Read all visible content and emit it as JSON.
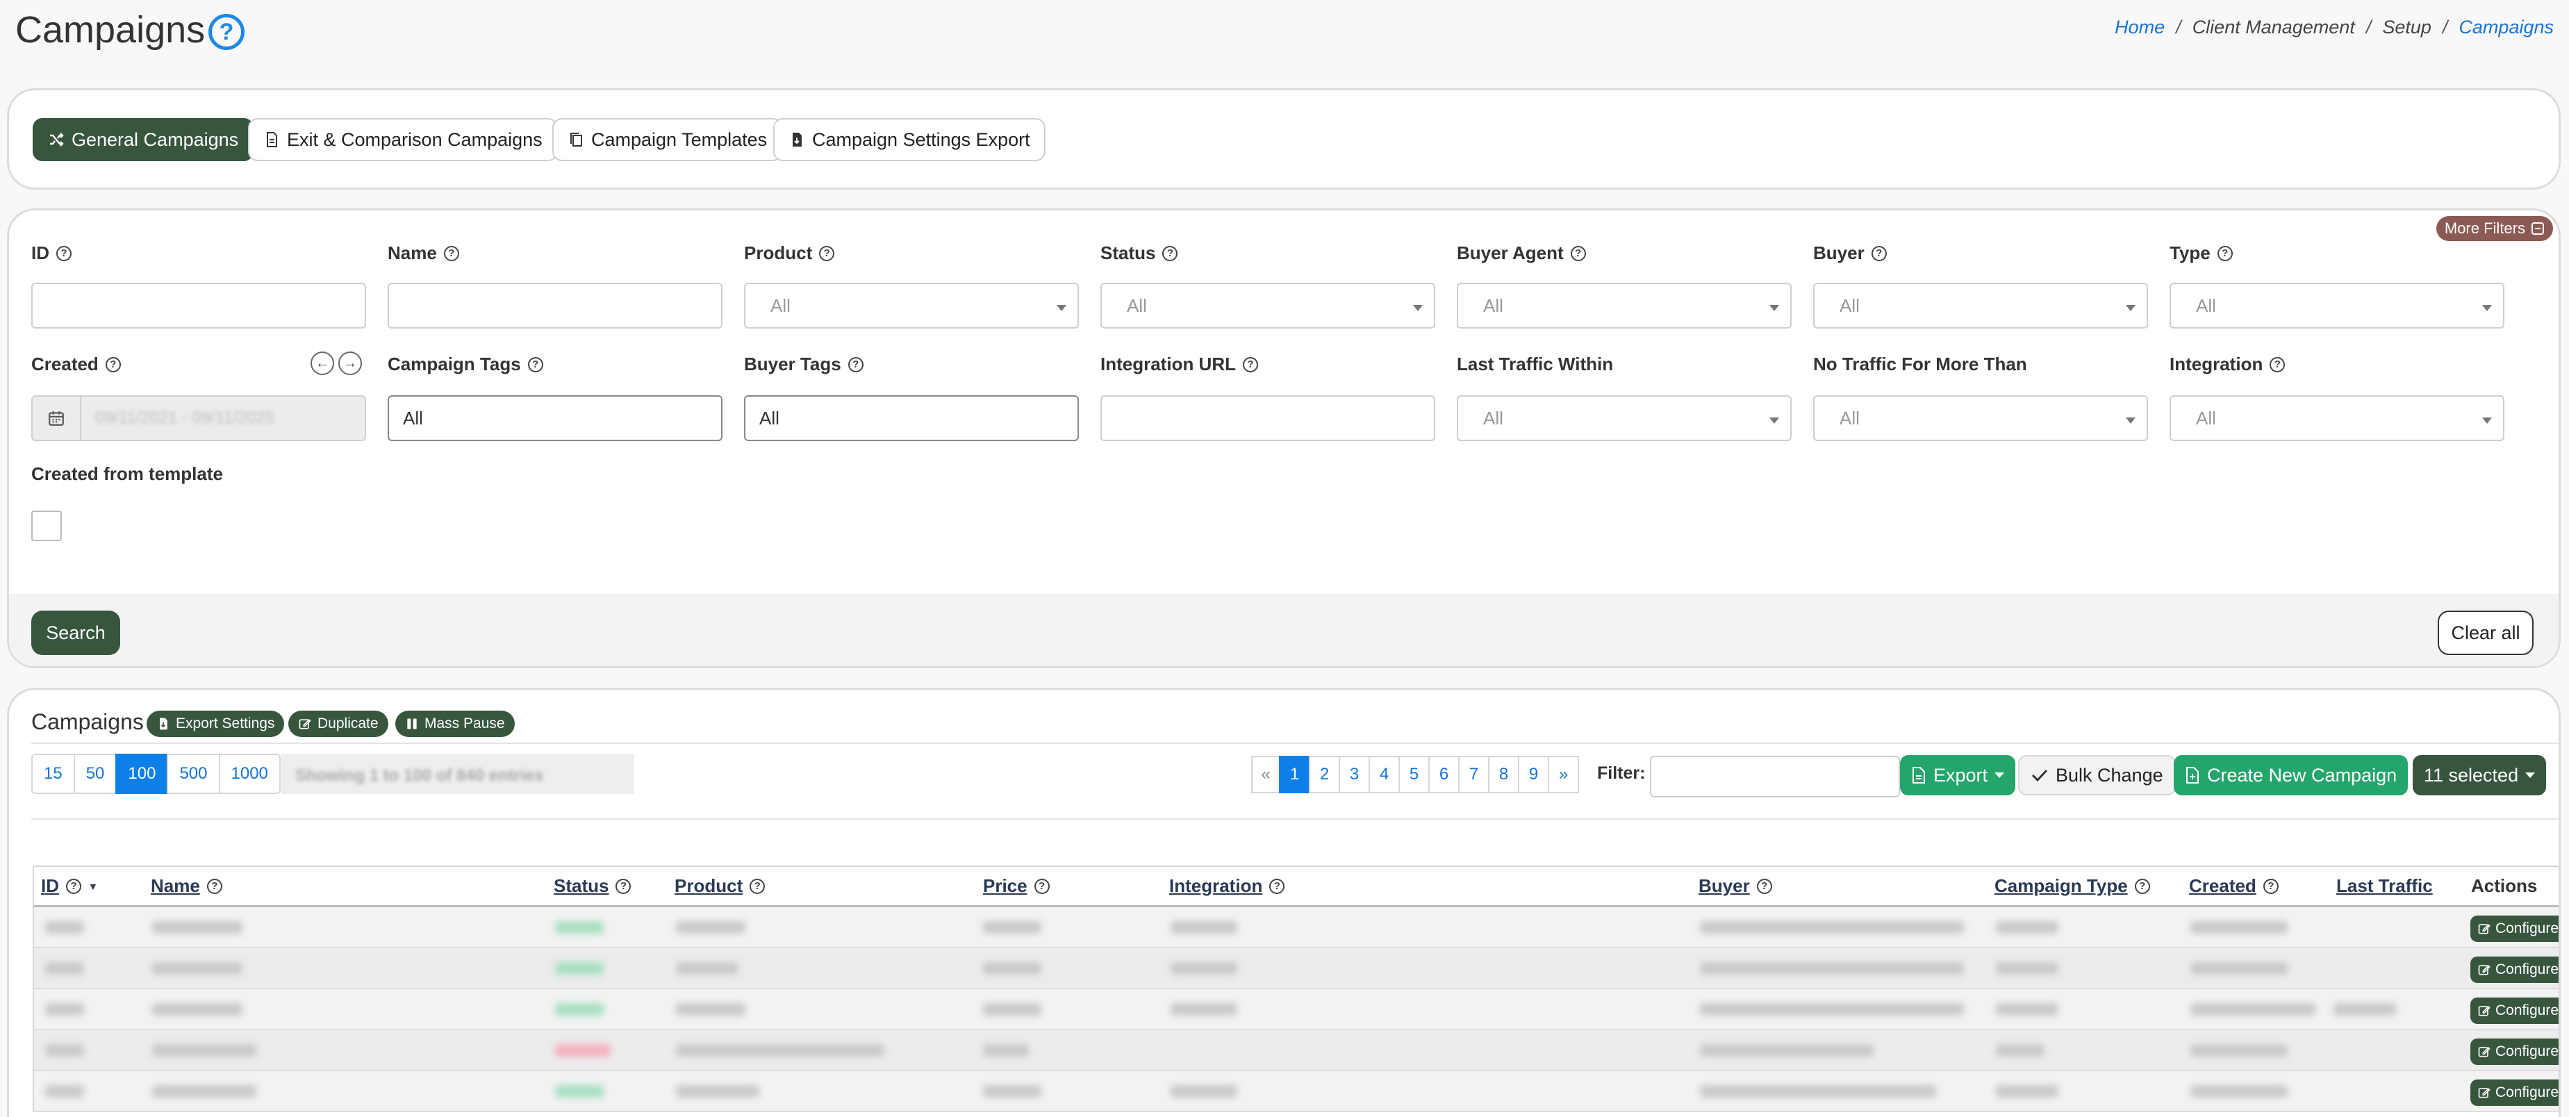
{
  "header": {
    "title": "Campaigns",
    "help_glyph": "?",
    "breadcrumb": {
      "home": "Home",
      "client_management": "Client Management",
      "setup": "Setup",
      "current": "Campaigns",
      "separator": "/"
    }
  },
  "tabs": {
    "general": "General Campaigns",
    "exit_comparison": "Exit & Comparison Campaigns",
    "templates": "Campaign Templates",
    "settings_export": "Campaign Settings Export"
  },
  "filters": {
    "more_filters": "More Filters",
    "id": "ID",
    "name": "Name",
    "product": {
      "label": "Product",
      "value": "All"
    },
    "status": {
      "label": "Status",
      "value": "All"
    },
    "buyer_agent": {
      "label": "Buyer Agent",
      "value": "All"
    },
    "buyer": {
      "label": "Buyer",
      "value": "All"
    },
    "type": {
      "label": "Type",
      "value": "All"
    },
    "created": {
      "label": "Created",
      "value": "09/11/2021 - 09/11/2025"
    },
    "campaign_tags": {
      "label": "Campaign Tags",
      "value": "All"
    },
    "buyer_tags": {
      "label": "Buyer Tags",
      "value": "All"
    },
    "integration_url": "Integration URL",
    "last_traffic_within": {
      "label": "Last Traffic Within",
      "value": "All"
    },
    "no_traffic_more_than": {
      "label": "No Traffic For More Than",
      "value": "All"
    },
    "integration": {
      "label": "Integration",
      "value": "All"
    },
    "created_from_template": "Created from template",
    "search": "Search",
    "clear_all": "Clear all"
  },
  "campaigns": {
    "title": "Campaigns",
    "export_settings": "Export Settings",
    "duplicate": "Duplicate",
    "mass_pause": "Mass Pause",
    "page_sizes": [
      "15",
      "50",
      "100",
      "500",
      "1000"
    ],
    "active_page_size": "100",
    "showing": "Showing 1 to 100 of 840 entries",
    "pages": [
      "«",
      "1",
      "2",
      "3",
      "4",
      "5",
      "6",
      "7",
      "8",
      "9",
      "»"
    ],
    "active_page": "1",
    "filter_label": "Filter:",
    "export": "Export",
    "bulk_change": "Bulk Change",
    "create_new": "Create New Campaign",
    "selected": "11 selected",
    "columns": {
      "id": "ID",
      "name": "Name",
      "status": "Status",
      "product": "Product",
      "price": "Price",
      "integration": "Integration",
      "buyer": "Buyer",
      "campaign_type": "Campaign Type",
      "created": "Created",
      "last_traffic": "Last Traffic",
      "actions": "Actions"
    },
    "configure": "Configure",
    "colors": {
      "accent_dark": "#37563d",
      "accent_green": "#24a56b",
      "link_blue": "#1874d2",
      "more_filters": "#8b5a54"
    }
  }
}
